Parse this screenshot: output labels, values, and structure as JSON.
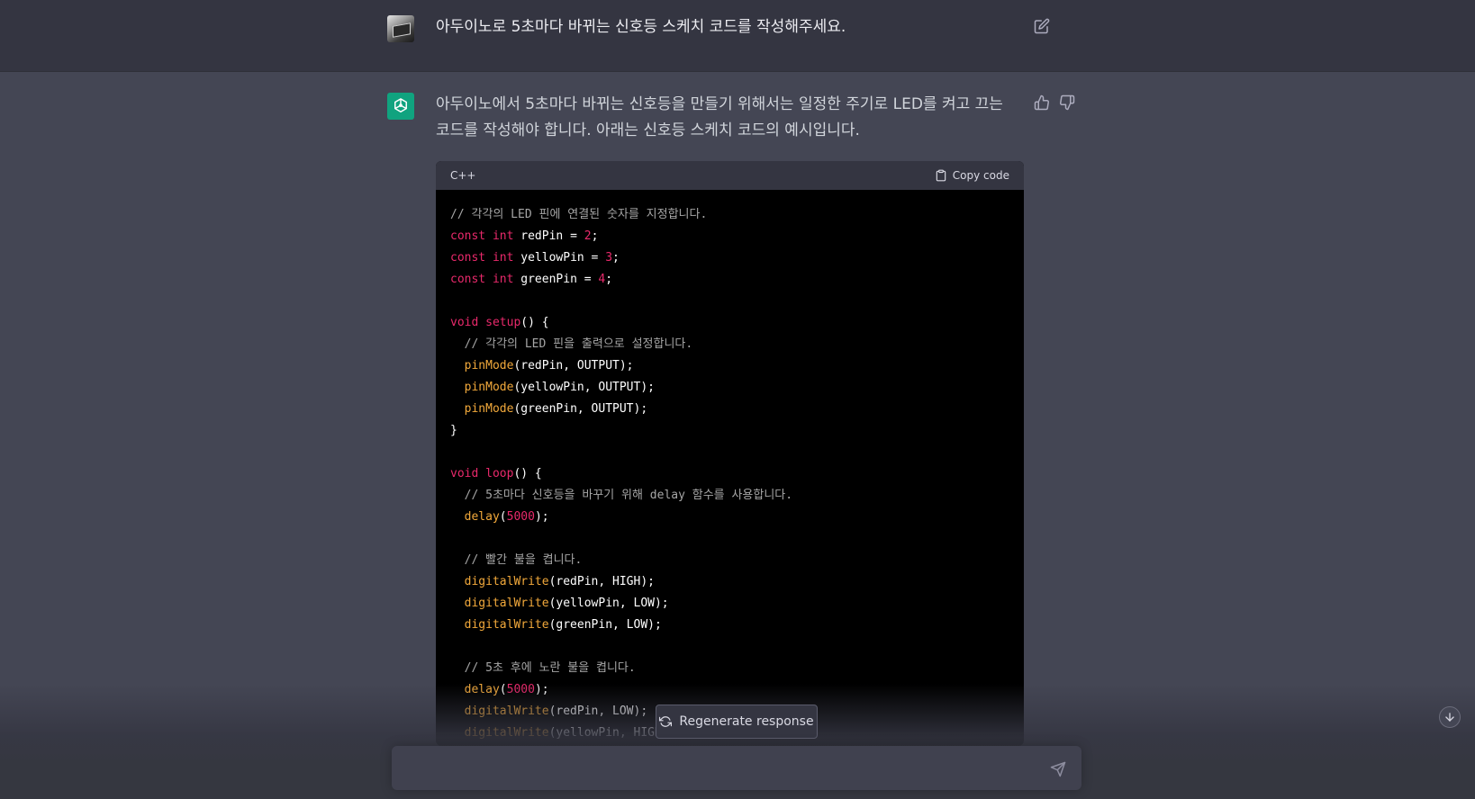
{
  "user_message": {
    "text": "아두이노로 5초마다 바뀌는 신호등 스케치 코드를 작성해주세요."
  },
  "assistant_message": {
    "text": "아두이노에서 5초마다 바뀌는 신호등을 만들기 위해서는 일정한 주기로 LED를 켜고 끄는 코드를 작성해야 합니다. 아래는 신호등 스케치 코드의 예시입니다."
  },
  "code_block": {
    "language": "C++",
    "copy_label": "Copy code",
    "lines": [
      [
        {
          "t": "// 각각의 LED 핀에 연결된 숫자를 지정합니다.",
          "c": "comment"
        }
      ],
      [
        {
          "t": "const",
          "c": "kw"
        },
        {
          "t": " "
        },
        {
          "t": "int",
          "c": "kw"
        },
        {
          "t": " redPin = "
        },
        {
          "t": "2",
          "c": "num"
        },
        {
          "t": ";"
        }
      ],
      [
        {
          "t": "const",
          "c": "kw"
        },
        {
          "t": " "
        },
        {
          "t": "int",
          "c": "kw"
        },
        {
          "t": " yellowPin = "
        },
        {
          "t": "3",
          "c": "num"
        },
        {
          "t": ";"
        }
      ],
      [
        {
          "t": "const",
          "c": "kw"
        },
        {
          "t": " "
        },
        {
          "t": "int",
          "c": "kw"
        },
        {
          "t": " greenPin = "
        },
        {
          "t": "4",
          "c": "num"
        },
        {
          "t": ";"
        }
      ],
      [],
      [
        {
          "t": "void",
          "c": "kw"
        },
        {
          "t": " "
        },
        {
          "t": "setup",
          "c": "kw"
        },
        {
          "t": "() {"
        }
      ],
      [
        {
          "t": "  "
        },
        {
          "t": "// 각각의 LED 핀을 출력으로 설정합니다.",
          "c": "comment"
        }
      ],
      [
        {
          "t": "  "
        },
        {
          "t": "pinMode",
          "c": "fn"
        },
        {
          "t": "(redPin, OUTPUT);"
        }
      ],
      [
        {
          "t": "  "
        },
        {
          "t": "pinMode",
          "c": "fn"
        },
        {
          "t": "(yellowPin, OUTPUT);"
        }
      ],
      [
        {
          "t": "  "
        },
        {
          "t": "pinMode",
          "c": "fn"
        },
        {
          "t": "(greenPin, OUTPUT);"
        }
      ],
      [
        {
          "t": "}"
        }
      ],
      [],
      [
        {
          "t": "void",
          "c": "kw"
        },
        {
          "t": " "
        },
        {
          "t": "loop",
          "c": "kw"
        },
        {
          "t": "() {"
        }
      ],
      [
        {
          "t": "  "
        },
        {
          "t": "// 5초마다 신호등을 바꾸기 위해 delay 함수를 사용합니다.",
          "c": "comment"
        }
      ],
      [
        {
          "t": "  "
        },
        {
          "t": "delay",
          "c": "fn"
        },
        {
          "t": "("
        },
        {
          "t": "5000",
          "c": "num"
        },
        {
          "t": ");"
        }
      ],
      [],
      [
        {
          "t": "  "
        },
        {
          "t": "// 빨간 불을 켭니다.",
          "c": "comment"
        }
      ],
      [
        {
          "t": "  "
        },
        {
          "t": "digitalWrite",
          "c": "fn"
        },
        {
          "t": "(redPin, HIGH);"
        }
      ],
      [
        {
          "t": "  "
        },
        {
          "t": "digitalWrite",
          "c": "fn"
        },
        {
          "t": "(yellowPin, LOW);"
        }
      ],
      [
        {
          "t": "  "
        },
        {
          "t": "digitalWrite",
          "c": "fn"
        },
        {
          "t": "(greenPin, LOW);"
        }
      ],
      [],
      [
        {
          "t": "  "
        },
        {
          "t": "// 5초 후에 노란 불을 켭니다.",
          "c": "comment"
        }
      ],
      [
        {
          "t": "  "
        },
        {
          "t": "delay",
          "c": "fn"
        },
        {
          "t": "("
        },
        {
          "t": "5000",
          "c": "num"
        },
        {
          "t": ");"
        }
      ],
      [
        {
          "t": "  "
        },
        {
          "t": "digitalWrite",
          "c": "fn"
        },
        {
          "t": "(redPin, LOW);"
        }
      ],
      [
        {
          "t": "  "
        },
        {
          "t": "digitalWrite",
          "c": "fn"
        },
        {
          "t": "(yellowPin, HIGH);"
        }
      ]
    ]
  },
  "regenerate_label": "Regenerate response",
  "input": {
    "value": "",
    "placeholder": ""
  },
  "colors": {
    "assistant_avatar": "#10a37f",
    "keyword": "#e9296b",
    "function": "#f2a93b",
    "comment": "#a6a6a6"
  },
  "icons": {
    "edit": "edit-icon",
    "thumb_up": "thumbs-up-icon",
    "thumb_down": "thumbs-down-icon",
    "copy": "clipboard-icon",
    "regenerate": "refresh-icon",
    "send": "send-icon",
    "scroll": "arrow-down-icon"
  }
}
